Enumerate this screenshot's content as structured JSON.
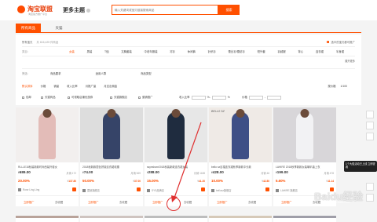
{
  "header": {
    "logo_text": "淘宝联盟",
    "logo_sub": "淘宝官方推广平台",
    "more_label": "更多主题",
    "search_placeholder": "输入关键词或宝贝链接搜索商品",
    "search_button": "搜索"
  },
  "tabs": [
    {
      "label": "所有商品"
    },
    {
      "label": "天猫"
    }
  ],
  "breadcrumb": {
    "root": "所有宝贝",
    "count": "共 616,425 件商品"
  },
  "top_right_link": "选中的宝贝都可推广",
  "category_label": "类目：",
  "categories": [
    "女装",
    "男装",
    "T恤",
    "文胸套装",
    "中老年服装",
    "衬衫",
    "休闲裤",
    "针织衫",
    "蕾丝衫/雪纺衫",
    "短外套",
    "羽绒服",
    "背心",
    "连衣裙",
    "半身裙"
  ],
  "categories_more": "展开更多",
  "dropdowns": {
    "label": "筛选：",
    "items": [
      "商品要求",
      "适用人群",
      "商品类型"
    ]
  },
  "sort": {
    "items": [
      "默认排序",
      "价格",
      "销量",
      "收入比率",
      "月推广量",
      "月支出佣金"
    ],
    "active_index": 0,
    "view_label": "按价格",
    "page": "1/100"
  },
  "filters": [
    "包邮",
    "天猫商品",
    "可领取店铺优惠券",
    "天猫旗舰店",
    "营销推广",
    "收入比率",
    "%-",
    "%",
    "价格",
    "-"
  ],
  "products": [
    {
      "brand": "",
      "title": "RLLLE18秋装新款时尚西装外套女",
      "price": "689.00",
      "sales": "月销 172",
      "rate": "20.00",
      "comm": "137.80",
      "shop": "Rose Ling Ling",
      "color": "#e8c9c6"
    },
    {
      "brand": "",
      "title": "2018秋新款撞色拼接连衣裙收腰",
      "price": "74.00",
      "sales": "月销 569",
      "rate": "50.00",
      "comm": "37.00",
      "shop": "茵曼旗舰店",
      "color": "#364468"
    },
    {
      "brand": "",
      "title": "ssyeshare2018秋装新款连衣裙女装",
      "price": "288.00",
      "sales": "月销 1188",
      "rate": "15.00",
      "comm": "41.20",
      "shop": "SYS品牌店",
      "color": "#1f2c3f"
    },
    {
      "brand": "BELLO SZ",
      "title": "bello sz百褶连衣裙秋季新款中长款",
      "price": "428.00",
      "sales": "月销 46",
      "rate": "10.00",
      "comm": "42.80",
      "shop": "bellosz旗舰店",
      "color": "#3e4f86"
    },
    {
      "brand": "",
      "title": "LAHIRE 2018秋季新款女装喇叭袖上衣",
      "price": "199.00",
      "sales": "月销 478",
      "rate": "5.60",
      "comm": "11.14",
      "shop": "LAHIRE 旗舰店",
      "color": "#e9e9ec"
    }
  ],
  "actions": {
    "promote": "立即推广",
    "collect": "去收藏"
  },
  "promo_overlay": "1个大促活动已上线 立即查看",
  "watermark": "Baidu经验",
  "watermark_sub": "jingyan.baidu.com",
  "colors": {
    "accent": "#ff5000"
  }
}
